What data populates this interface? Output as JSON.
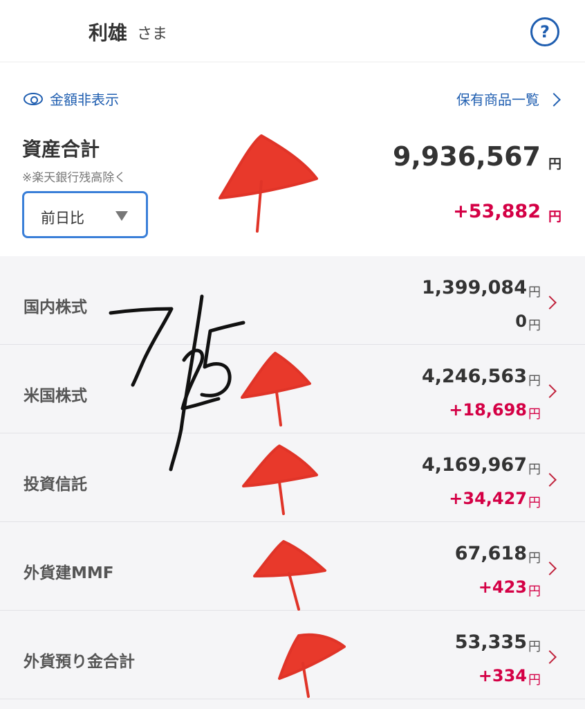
{
  "header": {
    "user_name": "利雄",
    "user_suffix": "さま",
    "help_icon": "?"
  },
  "summary": {
    "hide_amount_label": "金額非表示",
    "holdings_link_label": "保有商品一覧",
    "total_title": "資産合計",
    "total_note": "※楽天銀行残高除く",
    "compare_selected": "前日比",
    "total_value": "9,936,567",
    "total_unit": "円",
    "total_change": "+53,882",
    "total_change_unit": "円"
  },
  "assets": [
    {
      "label": "国内株式",
      "value": "1,399,084",
      "unit": "円",
      "change": "0",
      "change_unit": "円",
      "trend": "neutral"
    },
    {
      "label": "米国株式",
      "value": "4,246,563",
      "unit": "円",
      "change": "+18,698",
      "change_unit": "円",
      "trend": "up"
    },
    {
      "label": "投資信託",
      "value": "4,169,967",
      "unit": "円",
      "change": "+34,427",
      "change_unit": "円",
      "trend": "up"
    },
    {
      "label": "外貨建MMF",
      "value": "67,618",
      "unit": "円",
      "change": "+423",
      "change_unit": "円",
      "trend": "up"
    },
    {
      "label": "外貨預り金合計",
      "value": "53,335",
      "unit": "円",
      "change": "+334",
      "change_unit": "円",
      "trend": "up"
    }
  ],
  "colors": {
    "accent_blue": "#1f5eb0",
    "positive_red": "#d40045",
    "annotation_red": "#e8392b"
  },
  "icons": [
    "eye-icon",
    "chevron-right-icon",
    "help-icon",
    "dropdown-caret-icon"
  ]
}
